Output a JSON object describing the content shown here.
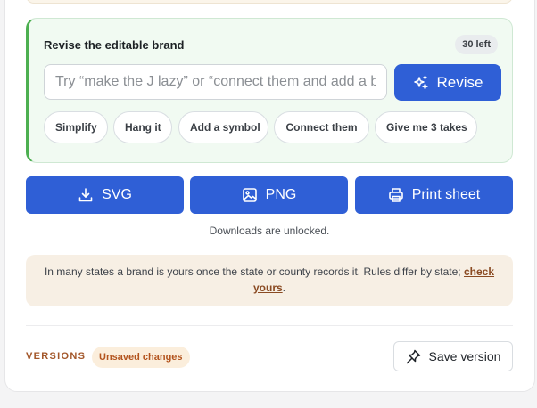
{
  "revise_panel": {
    "title": "Revise the editable brand",
    "counter": "30 left",
    "input": {
      "value": "",
      "placeholder": "Try “make the J lazy” or “connect them and add a bar”"
    },
    "revise_button_label": "Revise",
    "suggestions": [
      "Simplify",
      "Hang it",
      "Add a symbol",
      "Connect them",
      "Give me 3 takes"
    ]
  },
  "downloads": {
    "svg_label": "SVG",
    "png_label": "PNG",
    "print_label": "Print sheet",
    "note": "Downloads are unlocked."
  },
  "info": {
    "text": "In many states a brand is yours once the state or county records it. Rules differ by state;",
    "link_text": "check yours",
    "suffix": "."
  },
  "versions": {
    "label": "VERSIONS",
    "badge": "Unsaved changes",
    "save_button_label": "Save version"
  },
  "icons": {
    "revise": "sparkles-icon",
    "svg": "download-icon",
    "png": "image-icon",
    "print": "printer-icon",
    "save": "pin-icon"
  },
  "colors": {
    "primary": "#2f5fd6",
    "panel_bg": "#f1faf2",
    "panel_accent": "#4caf50",
    "info_bg": "#f7efe4",
    "link": "#8a4a22",
    "versions_label": "#a3572a",
    "badge_bg": "#fbeedc",
    "badge_text": "#b3541e"
  }
}
